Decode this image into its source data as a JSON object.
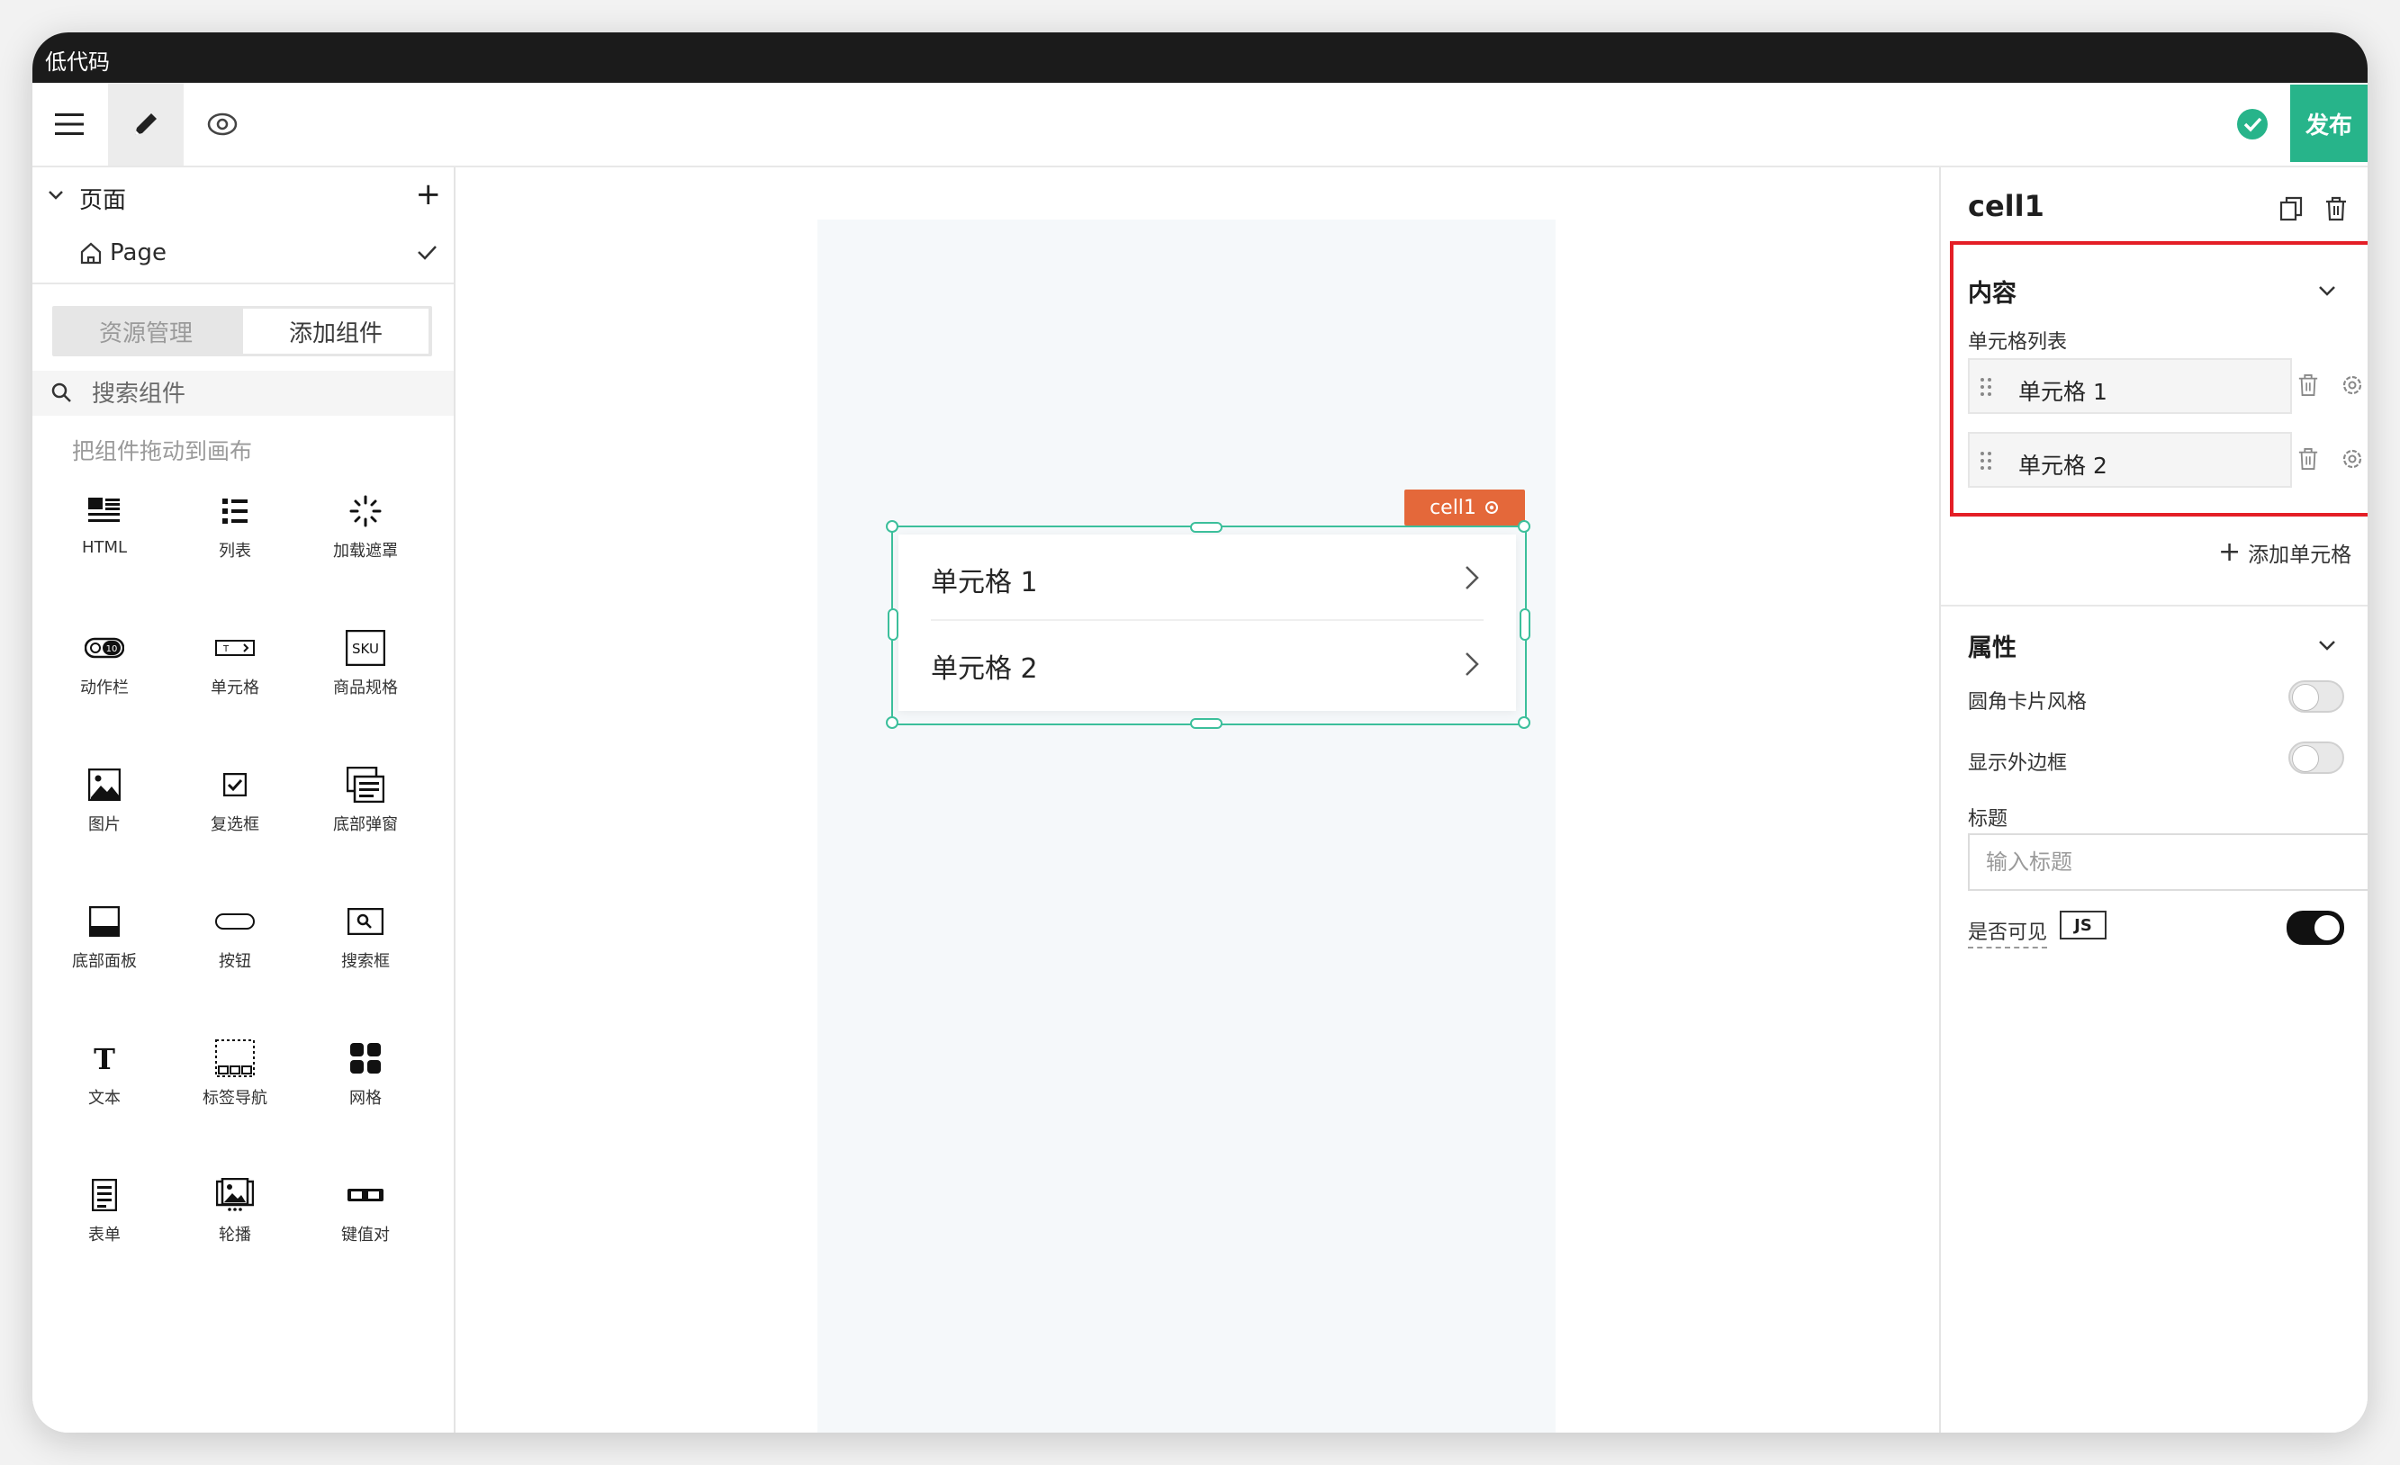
{
  "app": {
    "title": "低代码"
  },
  "toolbar": {
    "publish_label": "发布"
  },
  "left": {
    "pages_label": "页面",
    "page_name": "Page",
    "tabs": [
      "资源管理",
      "添加组件"
    ],
    "search_placeholder": "搜索组件",
    "hint": "把组件拖动到画布",
    "components": [
      {
        "label": "HTML",
        "icon": "html-icon"
      },
      {
        "label": "列表",
        "icon": "list-icon"
      },
      {
        "label": "加载遮罩",
        "icon": "loading-icon"
      },
      {
        "label": "动作栏",
        "icon": "action-bar-icon"
      },
      {
        "label": "单元格",
        "icon": "cell-icon"
      },
      {
        "label": "商品规格",
        "icon": "sku-icon"
      },
      {
        "label": "图片",
        "icon": "image-icon"
      },
      {
        "label": "复选框",
        "icon": "checkbox-icon"
      },
      {
        "label": "底部弹窗",
        "icon": "bottom-popup-icon"
      },
      {
        "label": "底部面板",
        "icon": "bottom-panel-icon"
      },
      {
        "label": "按钮",
        "icon": "button-icon"
      },
      {
        "label": "搜索框",
        "icon": "searchbox-icon"
      },
      {
        "label": "文本",
        "icon": "text-icon"
      },
      {
        "label": "标签导航",
        "icon": "tab-nav-icon"
      },
      {
        "label": "网格",
        "icon": "grid-icon"
      },
      {
        "label": "表单",
        "icon": "form-icon"
      },
      {
        "label": "轮播",
        "icon": "carousel-icon"
      },
      {
        "label": "键值对",
        "icon": "key-value-icon"
      }
    ]
  },
  "canvas": {
    "selected_tag": "cell1",
    "cells": [
      "单元格 1",
      "单元格 2"
    ]
  },
  "right": {
    "component_name": "cell1",
    "content_section": "内容",
    "cell_list_label": "单元格列表",
    "cell_items": [
      "单元格 1",
      "单元格 2"
    ],
    "add_cell_label": "添加单元格",
    "props_section": "属性",
    "rounded_card_label": "圆角卡片风格",
    "rounded_card_on": false,
    "show_border_label": "显示外边框",
    "show_border_on": false,
    "title_label": "标题",
    "title_placeholder": "输入标题",
    "visible_label": "是否可见",
    "js_badge": "JS",
    "visible_on": true
  },
  "colors": {
    "accent": "#27b48a",
    "selection": "#3cbf9b",
    "tag": "#e4683a",
    "highlight": "#e41e26"
  }
}
